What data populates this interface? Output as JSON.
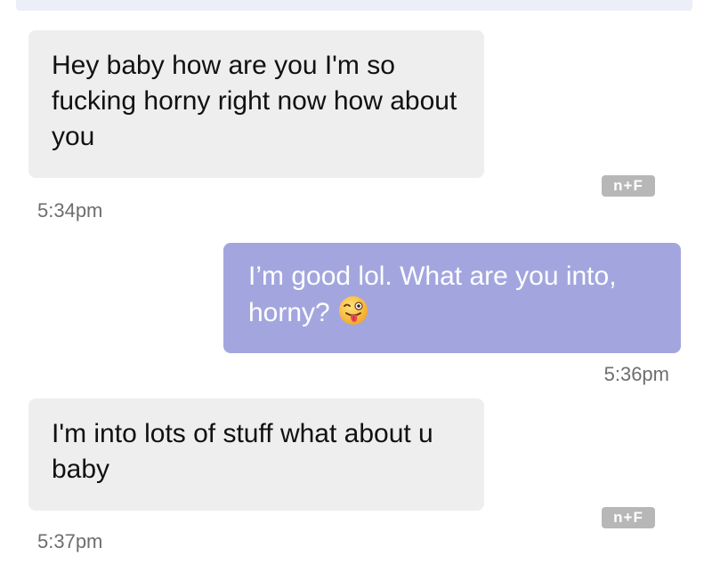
{
  "messages": [
    {
      "direction": "incoming",
      "text": "Hey baby how are you I'm so fucking horny right now how about you",
      "time": "5:34pm",
      "badge": "n+F"
    },
    {
      "direction": "outgoing",
      "text": "I’m good lol. What are you into, horny?",
      "emoji": "winking-face-with-tongue-icon",
      "time": "5:36pm"
    },
    {
      "direction": "incoming",
      "text": "I'm into lots of stuff what about u baby",
      "time": "5:37pm",
      "badge": "n+F"
    }
  ],
  "colors": {
    "incoming_bubble": "#eeeeee",
    "outgoing_bubble": "#a3a6de",
    "timestamp": "#6e6e6e",
    "badge": "#b7b7b7"
  }
}
